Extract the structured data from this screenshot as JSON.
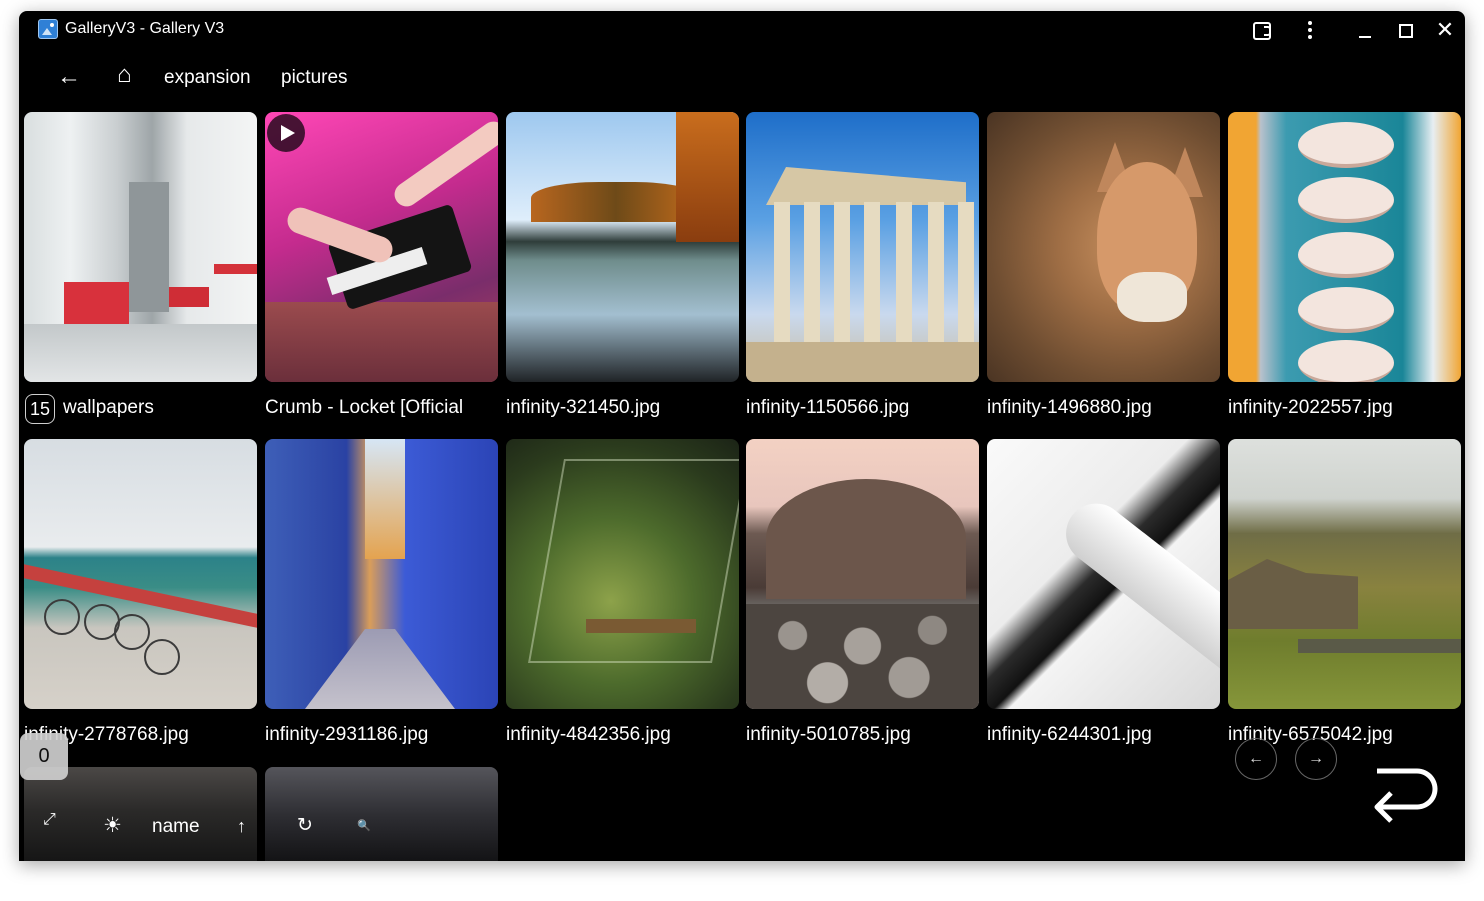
{
  "window": {
    "title": "GalleryV3 - Gallery V3",
    "icons": [
      "extension-icon",
      "more-vert-icon",
      "minimize-icon",
      "maximize-icon",
      "close-icon"
    ]
  },
  "nav": {
    "back_icon": "←",
    "home_icon": "⌂",
    "breadcrumbs": [
      "expansion",
      "pictures"
    ]
  },
  "grid": {
    "items": [
      {
        "label": "wallpapers",
        "count": "15",
        "kind": "folder"
      },
      {
        "label": "Crumb - Locket [Official",
        "kind": "video"
      },
      {
        "label": "infinity-321450.jpg",
        "kind": "image"
      },
      {
        "label": "infinity-1150566.jpg",
        "kind": "image"
      },
      {
        "label": "infinity-1496880.jpg",
        "kind": "image"
      },
      {
        "label": "infinity-2022557.jpg",
        "kind": "image"
      },
      {
        "label": "infinity-2778768.jpg",
        "kind": "image"
      },
      {
        "label": "infinity-2931186.jpg",
        "kind": "image"
      },
      {
        "label": "infinity-4842356.jpg",
        "kind": "image"
      },
      {
        "label": "infinity-5010785.jpg",
        "kind": "image"
      },
      {
        "label": "infinity-6244301.jpg",
        "kind": "image"
      },
      {
        "label": "infinity-6575042.jpg",
        "kind": "image"
      }
    ]
  },
  "toolbar": {
    "selected_count": "0",
    "expand_icon": "⤢",
    "theme_icon": "☀",
    "sort_label": "name",
    "sort_dir_icon": "↑",
    "refresh_icon": "↻",
    "search_icon": "🔍"
  },
  "pager": {
    "prev_icon": "←",
    "next_icon": "→"
  }
}
